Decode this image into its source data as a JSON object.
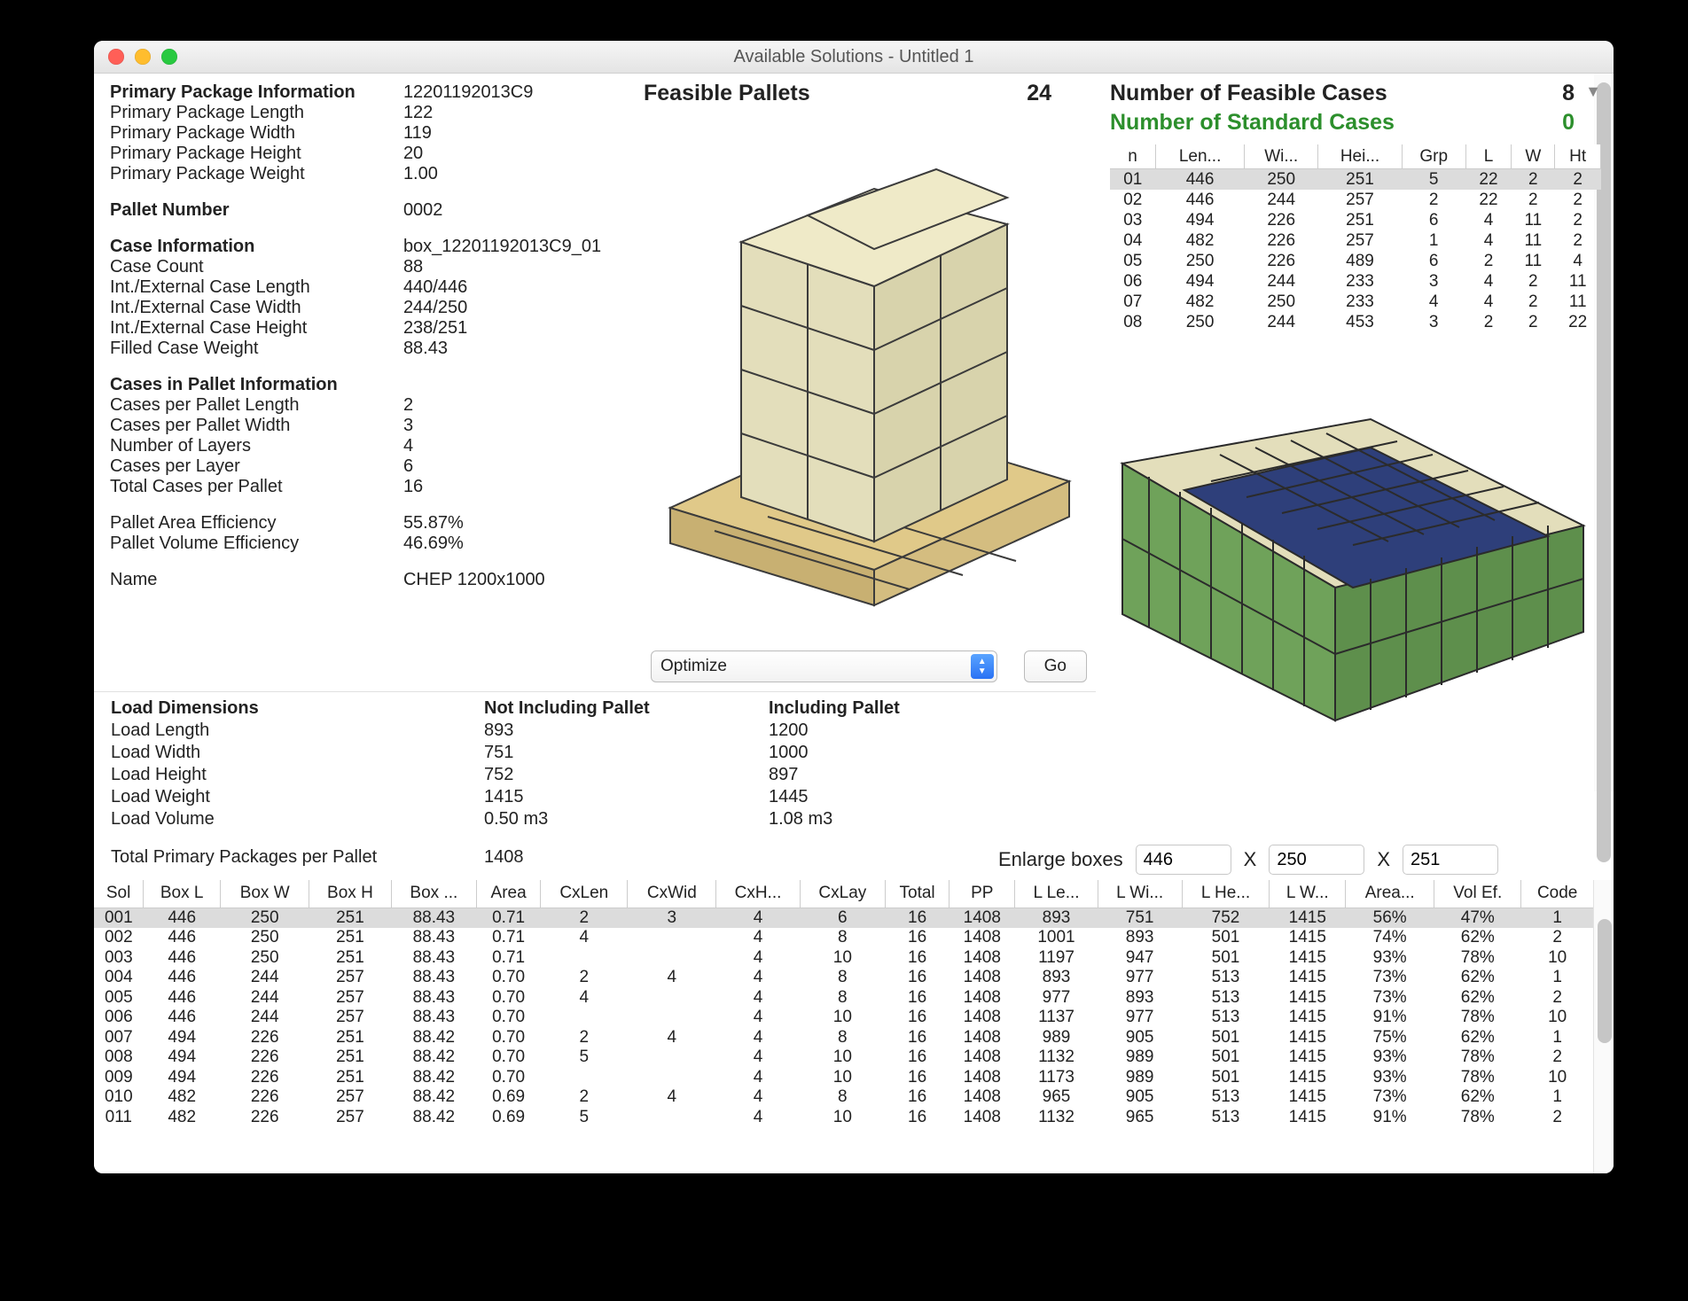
{
  "window_title": "Available Solutions - Untitled 1",
  "info": {
    "primary_header": "Primary Package Information",
    "primary_code": "12201192013C9",
    "ppl_label": "Primary Package Length",
    "ppl": "122",
    "ppw_label": "Primary Package Width",
    "ppw": "119",
    "pph_label": "Primary Package Height",
    "pph": "20",
    "ppwt_label": "Primary Package Weight",
    "ppwt": "1.00",
    "pallet_number_label": "Pallet Number",
    "pallet_number": "0002",
    "case_header": "Case Information",
    "case_code": "box_12201192013C9_01",
    "case_count_label": "Case Count",
    "case_count": "88",
    "iecl_label": "Int./External Case Length",
    "iecl": "440/446",
    "iecw_label": "Int./External Case Width",
    "iecw": "244/250",
    "iech_label": "Int./External Case Height",
    "iech": "238/251",
    "fcw_label": "Filled Case Weight",
    "fcw": "88.43",
    "cip_header": "Cases in Pallet Information",
    "cpl_label": "Cases per Pallet Length",
    "cpl": "2",
    "cpw_label": "Cases per Pallet Width",
    "cpw": "3",
    "nol_label": "Number of Layers",
    "nol": "4",
    "cplay_label": "Cases per Layer",
    "cplay": "6",
    "tcpp_label": "Total Cases per Pallet",
    "tcpp": "16",
    "pae_label": "Pallet Area Efficiency",
    "pae": "55.87%",
    "pve_label": "Pallet Volume Efficiency",
    "pve": "46.69%",
    "name_label": "Name",
    "name": "CHEP 1200x1000"
  },
  "center": {
    "feasible_label": "Feasible Pallets",
    "feasible_value": "24",
    "select_value": "Optimize",
    "go_label": "Go"
  },
  "right": {
    "feasible_cases_label": "Number of Feasible Cases",
    "feasible_cases_value": "8",
    "standard_cases_label": "Number of Standard Cases",
    "standard_cases_value": "0",
    "cases_columns": [
      "n",
      "Len...",
      "Wi...",
      "Hei...",
      "Grp",
      "L",
      "W",
      "Ht"
    ],
    "cases_rows": [
      [
        "01",
        "446",
        "250",
        "251",
        "5",
        "22",
        "2",
        "2"
      ],
      [
        "02",
        "446",
        "244",
        "257",
        "2",
        "22",
        "2",
        "2"
      ],
      [
        "03",
        "494",
        "226",
        "251",
        "6",
        "4",
        "11",
        "2"
      ],
      [
        "04",
        "482",
        "226",
        "257",
        "1",
        "4",
        "11",
        "2"
      ],
      [
        "05",
        "250",
        "226",
        "489",
        "6",
        "2",
        "11",
        "4"
      ],
      [
        "06",
        "494",
        "244",
        "233",
        "3",
        "4",
        "2",
        "11"
      ],
      [
        "07",
        "482",
        "250",
        "233",
        "4",
        "4",
        "2",
        "11"
      ],
      [
        "08",
        "250",
        "244",
        "453",
        "3",
        "2",
        "2",
        "22"
      ]
    ],
    "enlarge_label": "Enlarge boxes",
    "enlarge_x": "446",
    "enlarge_y": "250",
    "enlarge_z": "251",
    "x_sep": "X"
  },
  "load": {
    "header_c1": "Load Dimensions",
    "header_c2": "Not Including Pallet",
    "header_c3": "Including Pallet",
    "rows": [
      {
        "l": "Load Length",
        "a": "893",
        "b": "1200"
      },
      {
        "l": "Load Width",
        "a": "751",
        "b": "1000"
      },
      {
        "l": "Load Height",
        "a": "752",
        "b": "897"
      },
      {
        "l": "Load Weight",
        "a": "1415",
        "b": "1445"
      },
      {
        "l": "Load Volume",
        "a": "0.50 m3",
        "b": "1.08 m3"
      }
    ],
    "totals_label": "Total Primary Packages per Pallet",
    "totals_value": "1408"
  },
  "solutions": {
    "columns": [
      "Sol",
      "Box L",
      "Box W",
      "Box H",
      "Box ...",
      "Area",
      "CxLen",
      "CxWid",
      "CxH...",
      "CxLay",
      "Total",
      "PP",
      "L Le...",
      "L Wi...",
      "L He...",
      "L W...",
      "Area...",
      "Vol Ef.",
      "Code"
    ],
    "rows": [
      [
        "001",
        "446",
        "250",
        "251",
        "88.43",
        "0.71",
        "2",
        "3",
        "4",
        "6",
        "16",
        "1408",
        "893",
        "751",
        "752",
        "1415",
        "56%",
        "47%",
        "1"
      ],
      [
        "002",
        "446",
        "250",
        "251",
        "88.43",
        "0.71",
        "4",
        "",
        "4",
        "8",
        "16",
        "1408",
        "1001",
        "893",
        "501",
        "1415",
        "74%",
        "62%",
        "2"
      ],
      [
        "003",
        "446",
        "250",
        "251",
        "88.43",
        "0.71",
        "",
        "",
        "4",
        "10",
        "16",
        "1408",
        "1197",
        "947",
        "501",
        "1415",
        "93%",
        "78%",
        "10"
      ],
      [
        "004",
        "446",
        "244",
        "257",
        "88.43",
        "0.70",
        "2",
        "4",
        "4",
        "8",
        "16",
        "1408",
        "893",
        "977",
        "513",
        "1415",
        "73%",
        "62%",
        "1"
      ],
      [
        "005",
        "446",
        "244",
        "257",
        "88.43",
        "0.70",
        "4",
        "",
        "4",
        "8",
        "16",
        "1408",
        "977",
        "893",
        "513",
        "1415",
        "73%",
        "62%",
        "2"
      ],
      [
        "006",
        "446",
        "244",
        "257",
        "88.43",
        "0.70",
        "",
        "",
        "4",
        "10",
        "16",
        "1408",
        "1137",
        "977",
        "513",
        "1415",
        "91%",
        "78%",
        "10"
      ],
      [
        "007",
        "494",
        "226",
        "251",
        "88.42",
        "0.70",
        "2",
        "4",
        "4",
        "8",
        "16",
        "1408",
        "989",
        "905",
        "501",
        "1415",
        "75%",
        "62%",
        "1"
      ],
      [
        "008",
        "494",
        "226",
        "251",
        "88.42",
        "0.70",
        "5",
        "",
        "4",
        "10",
        "16",
        "1408",
        "1132",
        "989",
        "501",
        "1415",
        "93%",
        "78%",
        "2"
      ],
      [
        "009",
        "494",
        "226",
        "251",
        "88.42",
        "0.70",
        "",
        "",
        "4",
        "10",
        "16",
        "1408",
        "1173",
        "989",
        "501",
        "1415",
        "93%",
        "78%",
        "10"
      ],
      [
        "010",
        "482",
        "226",
        "257",
        "88.42",
        "0.69",
        "2",
        "4",
        "4",
        "8",
        "16",
        "1408",
        "965",
        "905",
        "513",
        "1415",
        "73%",
        "62%",
        "1"
      ],
      [
        "011",
        "482",
        "226",
        "257",
        "88.42",
        "0.69",
        "5",
        "",
        "4",
        "10",
        "16",
        "1408",
        "1132",
        "965",
        "513",
        "1415",
        "91%",
        "78%",
        "2"
      ]
    ]
  }
}
